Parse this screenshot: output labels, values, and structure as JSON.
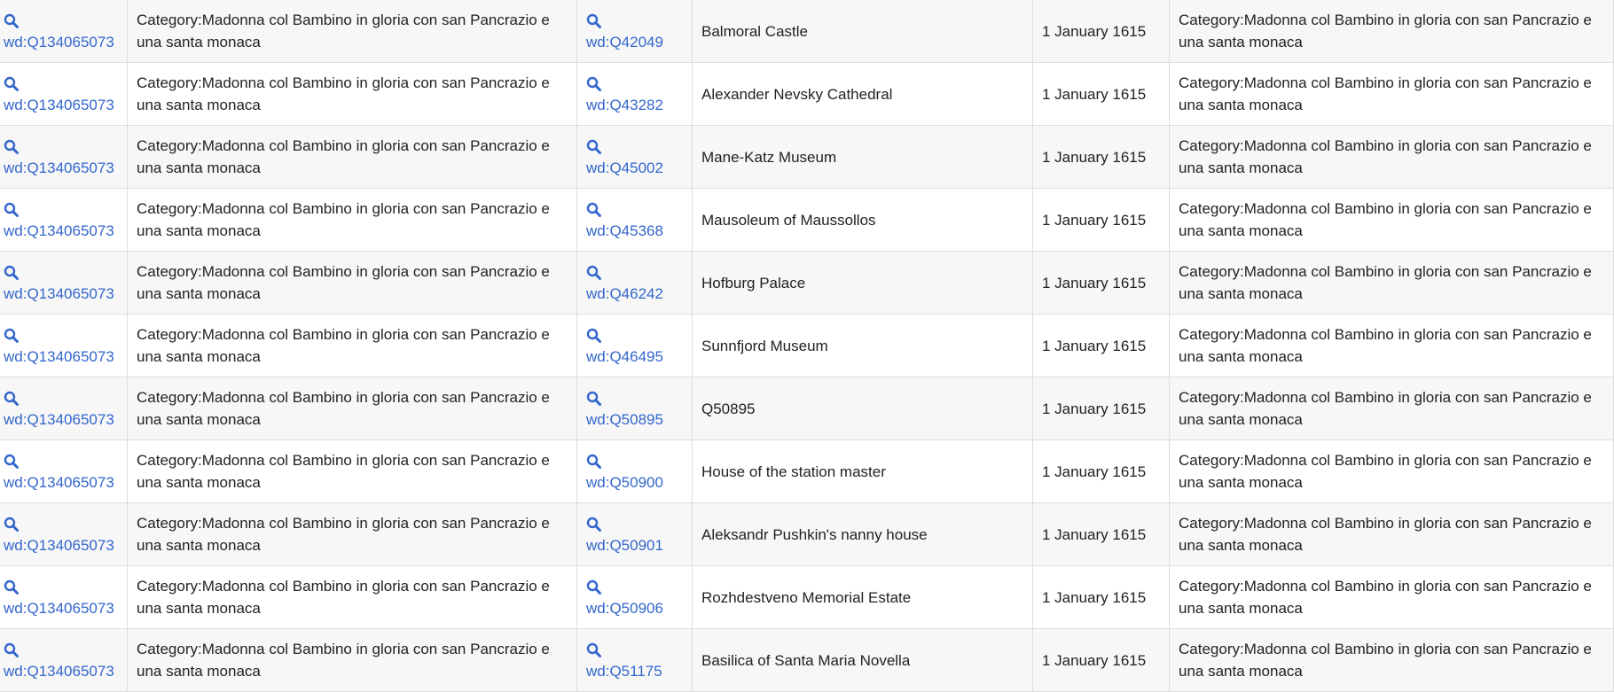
{
  "icons": {
    "search": "magnifier-icon"
  },
  "colors": {
    "link": "#3366cc",
    "text": "#222222",
    "row_alt": "#f7f7f7",
    "border": "#dddddd"
  },
  "rows": [
    {
      "item": "wd:Q134065073",
      "category": "Category:Madonna col Bambino in gloria con san Pancrazio e una santa monaca",
      "place": "wd:Q42049",
      "placeLabel": "Balmoral Castle",
      "date": "1 January 1615",
      "category2": "Category:Madonna col Bambino in gloria con san Pancrazio e una santa monaca"
    },
    {
      "item": "wd:Q134065073",
      "category": "Category:Madonna col Bambino in gloria con san Pancrazio e una santa monaca",
      "place": "wd:Q43282",
      "placeLabel": "Alexander Nevsky Cathedral",
      "date": "1 January 1615",
      "category2": "Category:Madonna col Bambino in gloria con san Pancrazio e una santa monaca"
    },
    {
      "item": "wd:Q134065073",
      "category": "Category:Madonna col Bambino in gloria con san Pancrazio e una santa monaca",
      "place": "wd:Q45002",
      "placeLabel": "Mane-Katz Museum",
      "date": "1 January 1615",
      "category2": "Category:Madonna col Bambino in gloria con san Pancrazio e una santa monaca"
    },
    {
      "item": "wd:Q134065073",
      "category": "Category:Madonna col Bambino in gloria con san Pancrazio e una santa monaca",
      "place": "wd:Q45368",
      "placeLabel": "Mausoleum of Maussollos",
      "date": "1 January 1615",
      "category2": "Category:Madonna col Bambino in gloria con san Pancrazio e una santa monaca"
    },
    {
      "item": "wd:Q134065073",
      "category": "Category:Madonna col Bambino in gloria con san Pancrazio e una santa monaca",
      "place": "wd:Q46242",
      "placeLabel": "Hofburg Palace",
      "date": "1 January 1615",
      "category2": "Category:Madonna col Bambino in gloria con san Pancrazio e una santa monaca"
    },
    {
      "item": "wd:Q134065073",
      "category": "Category:Madonna col Bambino in gloria con san Pancrazio e una santa monaca",
      "place": "wd:Q46495",
      "placeLabel": "Sunnfjord Museum",
      "date": "1 January 1615",
      "category2": "Category:Madonna col Bambino in gloria con san Pancrazio e una santa monaca"
    },
    {
      "item": "wd:Q134065073",
      "category": "Category:Madonna col Bambino in gloria con san Pancrazio e una santa monaca",
      "place": "wd:Q50895",
      "placeLabel": "Q50895",
      "date": "1 January 1615",
      "category2": "Category:Madonna col Bambino in gloria con san Pancrazio e una santa monaca"
    },
    {
      "item": "wd:Q134065073",
      "category": "Category:Madonna col Bambino in gloria con san Pancrazio e una santa monaca",
      "place": "wd:Q50900",
      "placeLabel": "House of the station master",
      "date": "1 January 1615",
      "category2": "Category:Madonna col Bambino in gloria con san Pancrazio e una santa monaca"
    },
    {
      "item": "wd:Q134065073",
      "category": "Category:Madonna col Bambino in gloria con san Pancrazio e una santa monaca",
      "place": "wd:Q50901",
      "placeLabel": "Aleksandr Pushkin's nanny house",
      "date": "1 January 1615",
      "category2": "Category:Madonna col Bambino in gloria con san Pancrazio e una santa monaca"
    },
    {
      "item": "wd:Q134065073",
      "category": "Category:Madonna col Bambino in gloria con san Pancrazio e una santa monaca",
      "place": "wd:Q50906",
      "placeLabel": "Rozhdestveno Memorial Estate",
      "date": "1 January 1615",
      "category2": "Category:Madonna col Bambino in gloria con san Pancrazio e una santa monaca"
    },
    {
      "item": "wd:Q134065073",
      "category": "Category:Madonna col Bambino in gloria con san Pancrazio e una santa monaca",
      "place": "wd:Q51175",
      "placeLabel": "Basilica of Santa Maria Novella",
      "date": "1 January 1615",
      "category2": "Category:Madonna col Bambino in gloria con san Pancrazio e una santa monaca"
    }
  ]
}
